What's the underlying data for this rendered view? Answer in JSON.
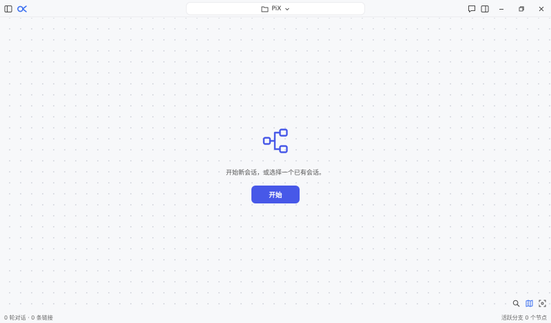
{
  "titlebar": {
    "project_name": "PiX",
    "icons": {
      "sidebar_toggle": "sidebar-toggle-icon",
      "logo": "app-logo",
      "folder": "folder-icon",
      "chevron": "chevron-down-icon",
      "chat": "chat-icon",
      "panel": "panel-icon",
      "minimize": "minimize-icon",
      "restore": "restore-icon",
      "close": "close-icon"
    }
  },
  "colors": {
    "accent": "#4758e8",
    "background": "#f7f8fa",
    "logo": "#3b6ff0"
  },
  "main": {
    "empty_message": "开始新会话，或选择一个已有会话。",
    "start_label": "开始"
  },
  "canvas_tools": {
    "icons": [
      "search-icon",
      "map-icon",
      "fit-view-icon"
    ]
  },
  "status": {
    "left": "0 轮对话 · 0 条链接",
    "right": "活跃分支 0 个节点"
  }
}
